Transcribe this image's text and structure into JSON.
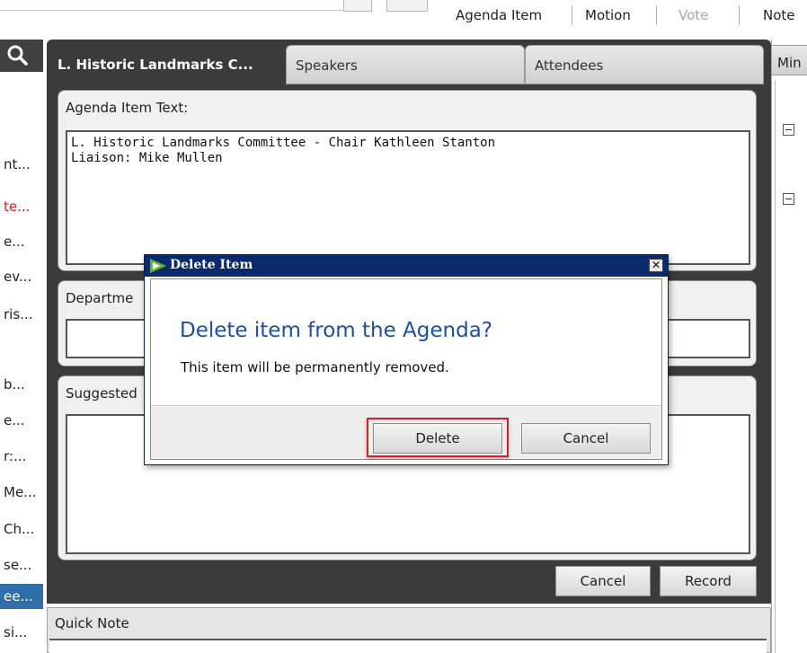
{
  "toolbar": {
    "items": [
      {
        "label": "Agenda Item",
        "enabled": true
      },
      {
        "label": "Motion",
        "enabled": true
      },
      {
        "label": "Vote",
        "enabled": false
      },
      {
        "label": "Note",
        "enabled": true
      }
    ]
  },
  "sidebar": {
    "search_icon": "search-icon",
    "items": [
      {
        "label": "nt...",
        "state": "normal"
      },
      {
        "label": "te...",
        "state": "red"
      },
      {
        "label": "e...",
        "state": "normal"
      },
      {
        "label": "ev...",
        "state": "normal"
      },
      {
        "label": "ris...",
        "state": "normal"
      },
      {
        "label": "b...",
        "state": "normal"
      },
      {
        "label": "e...",
        "state": "normal"
      },
      {
        "label": "r:...",
        "state": "normal"
      },
      {
        "label": "Me...",
        "state": "normal"
      },
      {
        "label": "Ch...",
        "state": "normal"
      },
      {
        "label": "se...",
        "state": "normal"
      },
      {
        "label": "ee...",
        "state": "selected"
      },
      {
        "label": "si...",
        "state": "normal"
      }
    ]
  },
  "tabs": [
    {
      "label": "L. Historic Landmarks C...",
      "active": true
    },
    {
      "label": "Speakers",
      "active": false
    },
    {
      "label": "Attendees",
      "active": false
    }
  ],
  "agenda_item": {
    "label": "Agenda Item Text:",
    "lines": [
      "L. Historic Landmarks Committee - Chair Kathleen Stanton",
      "Liaison: Mike Mullen"
    ]
  },
  "department": {
    "label": "Departme"
  },
  "suggested": {
    "label": "Suggested"
  },
  "footer_buttons": {
    "cancel": "Cancel",
    "record": "Record"
  },
  "quick_note": {
    "label": "Quick Note"
  },
  "right_panel": {
    "label": "Min"
  },
  "dialog": {
    "title": "Delete Item",
    "close": "✕",
    "heading": "Delete item from the Agenda?",
    "message": "This item will be permanently removed.",
    "delete_label": "Delete",
    "cancel_label": "Cancel",
    "accent": "#1f4fa0",
    "focus_color": "#d42027"
  }
}
